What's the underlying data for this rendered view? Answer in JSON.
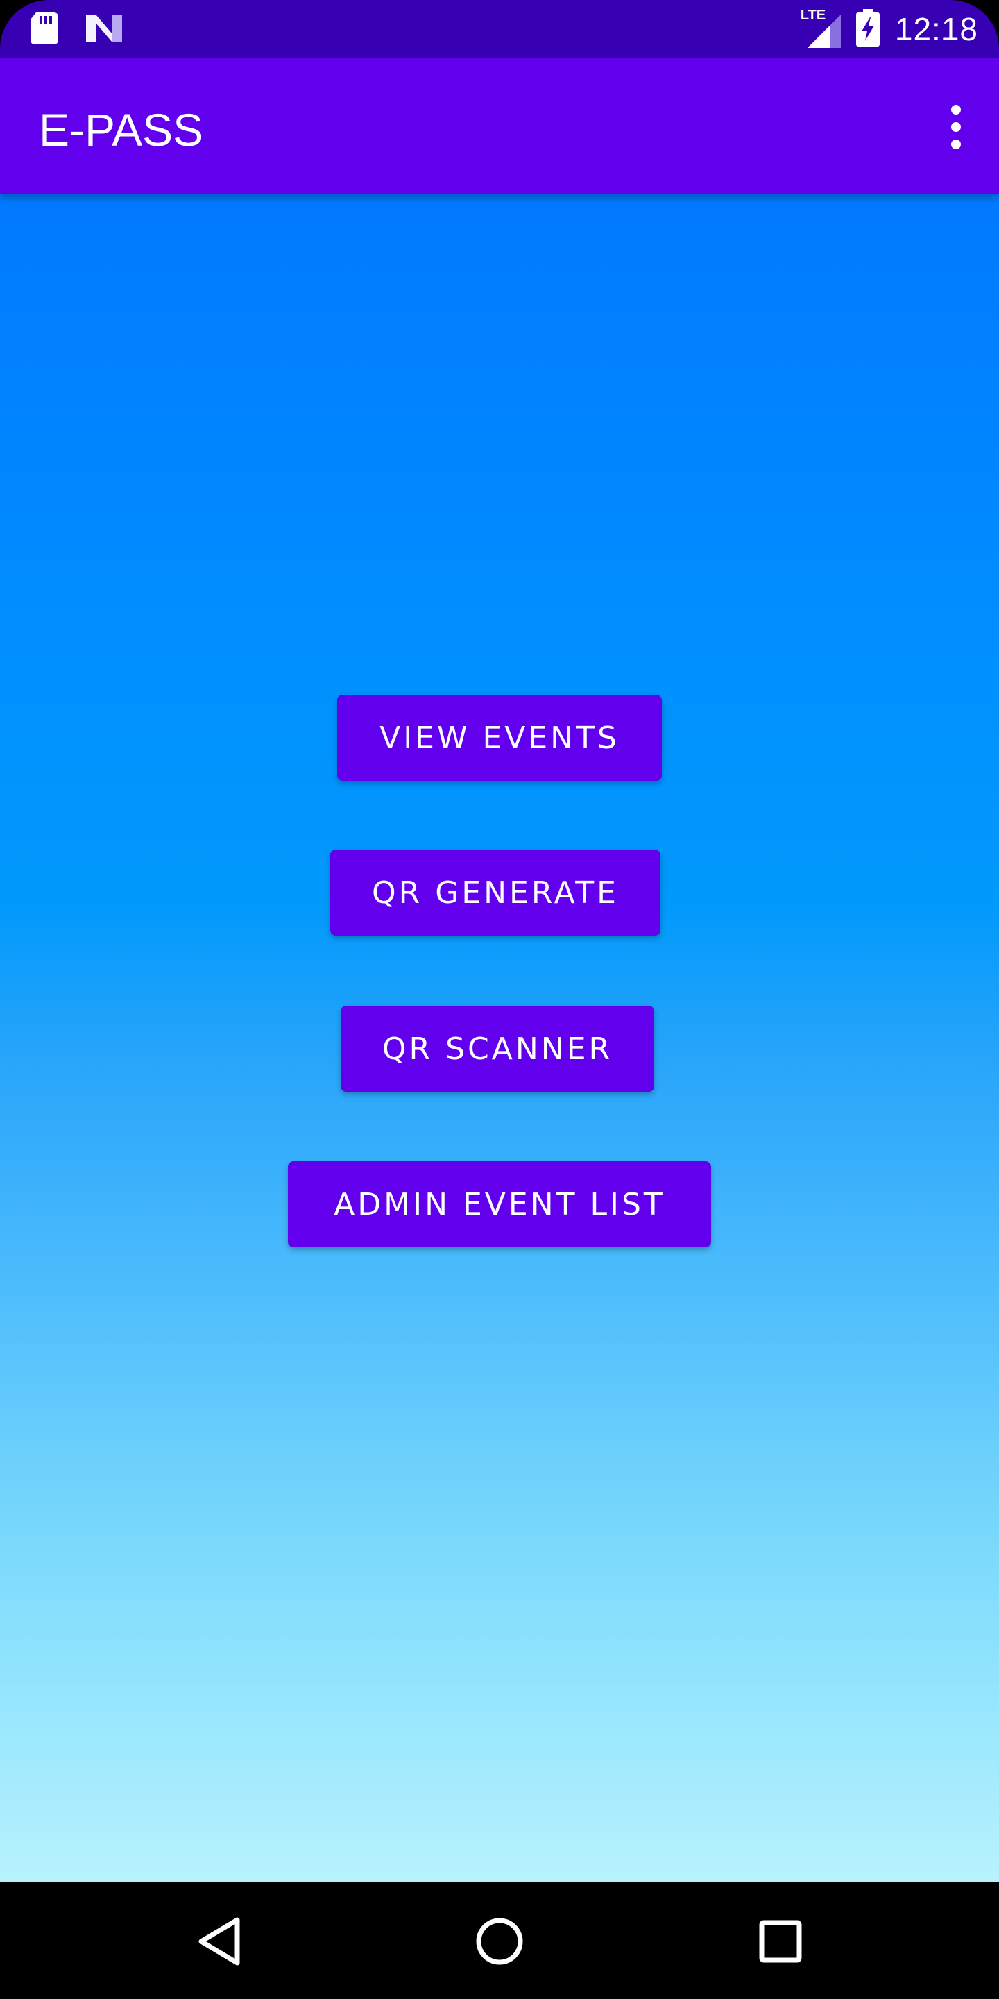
{
  "status_bar": {
    "time": "12:18",
    "network_label": "LTE",
    "icons": [
      "sd-card-icon",
      "notification-n-icon",
      "lte-signal-icon",
      "battery-charging-icon"
    ]
  },
  "app_bar": {
    "title": "E-PASS",
    "overflow_icon": "more-vert-icon"
  },
  "buttons": {
    "view_events": "VIEW EVENTS",
    "qr_generate": "QR GENERATE",
    "qr_scanner": "QR SCANNER",
    "admin_event_list": "ADMIN EVENT LIST"
  },
  "nav_bar": {
    "icons": [
      "back-icon",
      "home-icon",
      "recents-icon"
    ]
  },
  "colors": {
    "status_bar": "#3700b3",
    "app_bar": "#6200ee",
    "button": "#6200ee",
    "gradient_top": "#0179ff",
    "gradient_bottom": "#b8f2fd",
    "nav_bar": "#000000"
  }
}
